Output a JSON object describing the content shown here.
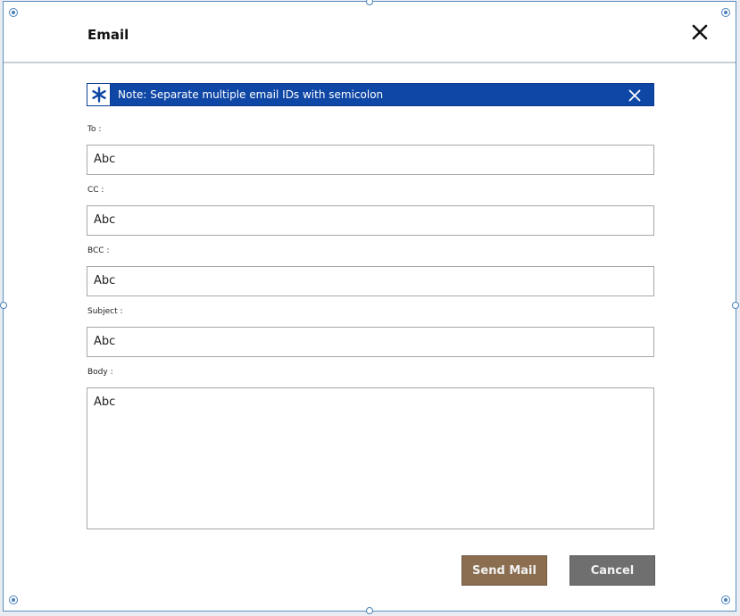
{
  "dialog": {
    "title": "Email",
    "close_icon": "close-icon"
  },
  "note": {
    "icon": "asterisk-icon",
    "text": "Note: Separate multiple email IDs with semicolon",
    "close_icon": "close-icon",
    "background_color": "#0f47a6"
  },
  "fields": {
    "to": {
      "label": "To :",
      "value": "Abc"
    },
    "cc": {
      "label": "CC :",
      "value": "Abc"
    },
    "bcc": {
      "label": "BCC :",
      "value": "Abc"
    },
    "subject": {
      "label": "Subject :",
      "value": "Abc"
    },
    "body": {
      "label": "Body :",
      "value": "Abc"
    }
  },
  "buttons": {
    "send": {
      "label": "Send Mail",
      "color": "#8b6e50"
    },
    "cancel": {
      "label": "Cancel",
      "color": "#6f6f6f"
    }
  }
}
